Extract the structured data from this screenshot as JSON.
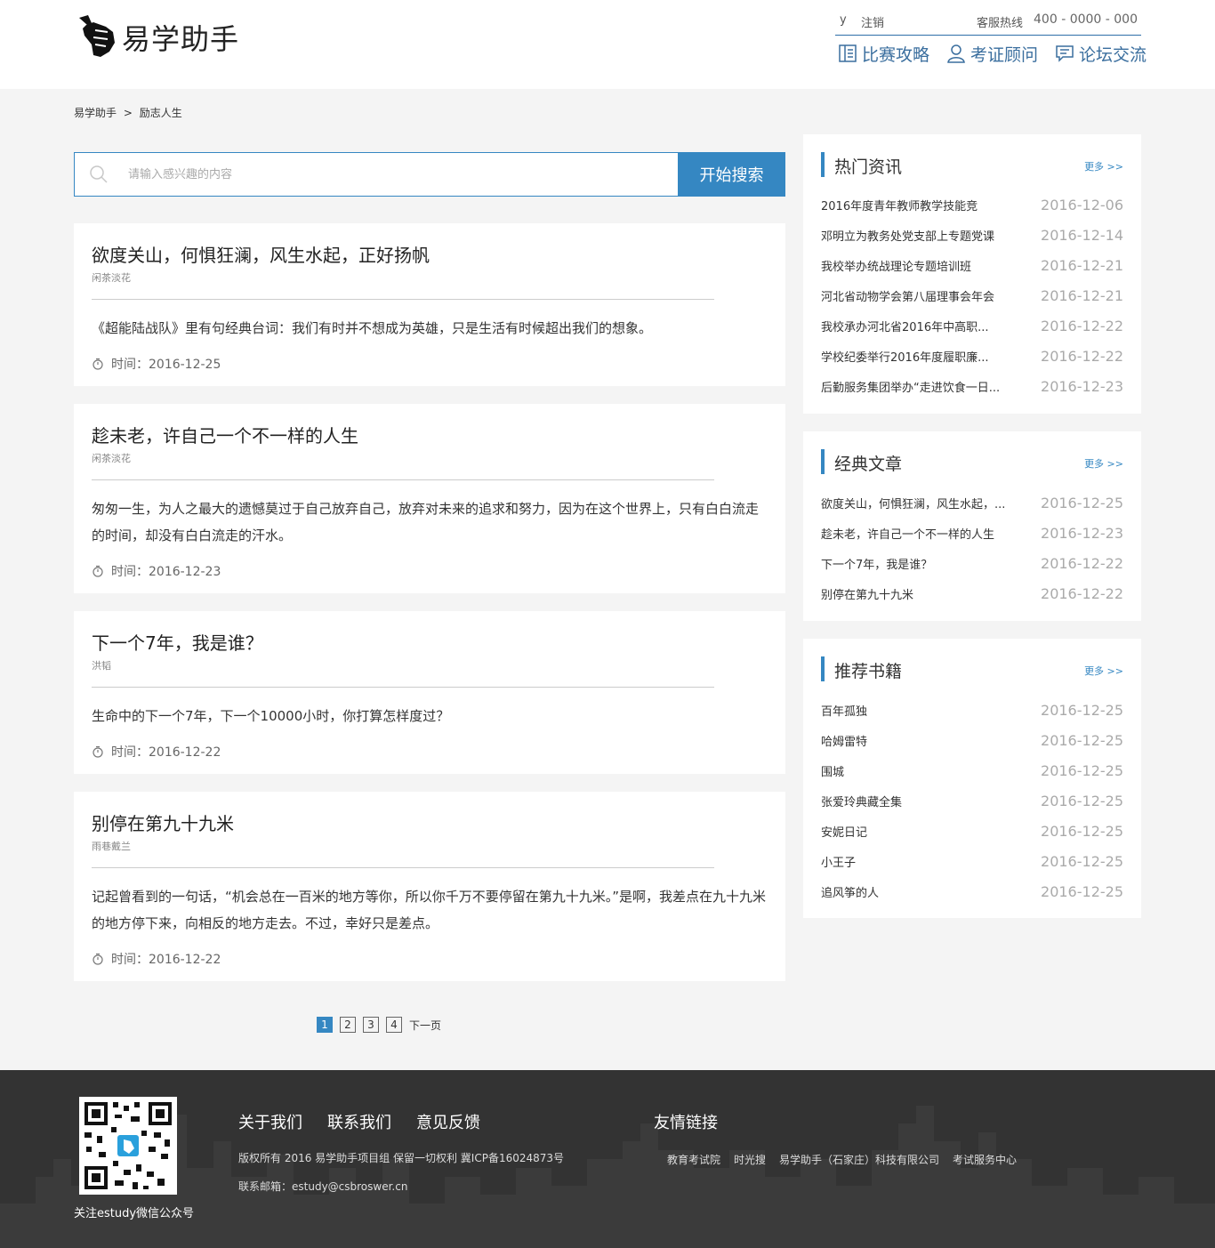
{
  "header": {
    "logo_text": "易学助手",
    "user": "y",
    "logout": "注销",
    "hotline_label": "客服热线",
    "hotline": "400 - 0000 - 000",
    "nav": [
      {
        "label": "比赛攻略",
        "icon": "book-icon"
      },
      {
        "label": "考证顾问",
        "icon": "user-icon"
      },
      {
        "label": "论坛交流",
        "icon": "chat-icon"
      }
    ]
  },
  "breadcrumb": {
    "home": "易学助手",
    "separator": ">",
    "current": "励志人生"
  },
  "search": {
    "placeholder": "请输入感兴趣的内容",
    "button": "开始搜索"
  },
  "articles": [
    {
      "title": "欲度关山，何惧狂澜，风生水起，正好扬帆",
      "author": "闲茶淡花",
      "summary": "《超能陆战队》里有句经典台词：我们有时并不想成为英雄，只是生活有时候超出我们的想象。",
      "time": "时间：2016-12-25"
    },
    {
      "title": "趁未老，许自己一个不一样的人生",
      "author": "闲茶淡花",
      "summary": "匆匆一生，为人之最大的遗憾莫过于自己放弃自己，放弃对未来的追求和努力，因为在这个世界上，只有白白流走的时间，却没有白白流走的汗水。",
      "time": "时间：2016-12-23"
    },
    {
      "title": "下一个7年，我是谁？",
      "author": "洪韬",
      "summary": "生命中的下一个7年，下一个10000小时，你打算怎样度过？",
      "time": "时间：2016-12-22"
    },
    {
      "title": "别停在第九十九米",
      "author": "雨巷戴兰",
      "summary": "记起曾看到的一句话，“机会总在一百米的地方等你，所以你千万不要停留在第九十九米。”是啊，我差点在九十九米的地方停下来，向相反的地方走去。不过，幸好只是差点。",
      "time": "时间：2016-12-22"
    }
  ],
  "pagination": {
    "pages": [
      "1",
      "2",
      "3",
      "4"
    ],
    "current": "1",
    "next": "下一页"
  },
  "sidebar": {
    "hot": {
      "title": "热门资讯",
      "more": "更多 >>",
      "items": [
        {
          "name": "2016年度青年教师教学技能竞",
          "date": "2016-12-06"
        },
        {
          "name": "邓明立为教务处党支部上专题党课",
          "date": "2016-12-14"
        },
        {
          "name": "我校举办统战理论专题培训班",
          "date": "2016-12-21"
        },
        {
          "name": "河北省动物学会第八届理事会年会",
          "date": "2016-12-21"
        },
        {
          "name": "我校承办河北省2016年中高职...",
          "date": "2016-12-22"
        },
        {
          "name": "学校纪委举行2016年度履职廉...",
          "date": "2016-12-22"
        },
        {
          "name": "后勤服务集团举办“走进饮食一日...",
          "date": "2016-12-23"
        }
      ]
    },
    "classic": {
      "title": "经典文章",
      "more": "更多 >>",
      "items": [
        {
          "name": "欲度关山，何惧狂澜，风生水起，...",
          "date": "2016-12-25"
        },
        {
          "name": "趁未老，许自己一个不一样的人生",
          "date": "2016-12-23"
        },
        {
          "name": "下一个7年，我是谁？",
          "date": "2016-12-22"
        },
        {
          "name": "别停在第九十九米",
          "date": "2016-12-22"
        }
      ]
    },
    "books": {
      "title": "推荐书籍",
      "more": "更多 >>",
      "items": [
        {
          "name": "百年孤独",
          "date": "2016-12-25"
        },
        {
          "name": "哈姆雷特",
          "date": "2016-12-25"
        },
        {
          "name": "围城",
          "date": "2016-12-25"
        },
        {
          "name": "张爱玲典藏全集",
          "date": "2016-12-25"
        },
        {
          "name": "安妮日记",
          "date": "2016-12-25"
        },
        {
          "name": "小王子",
          "date": "2016-12-25"
        },
        {
          "name": "追风筝的人",
          "date": "2016-12-25"
        }
      ]
    }
  },
  "footer": {
    "qr_caption": "关注estudy微信公众号",
    "links": [
      "关于我们",
      "联系我们",
      "意见反馈"
    ],
    "copyright": "版权所有 2016 易学助手项目组 保留一切权利 冀ICP备16024873号",
    "email": "联系邮箱：estudy@csbroswer.cn",
    "friend_title": "友情链接",
    "friends": [
      "教育考试院",
      "时光搜",
      "易学助手（石家庄）科技有限公司",
      "考试服务中心"
    ]
  },
  "colors": {
    "accent": "#3587c2",
    "footer_bg": "#333333",
    "page_bg": "#f4f4f4"
  }
}
